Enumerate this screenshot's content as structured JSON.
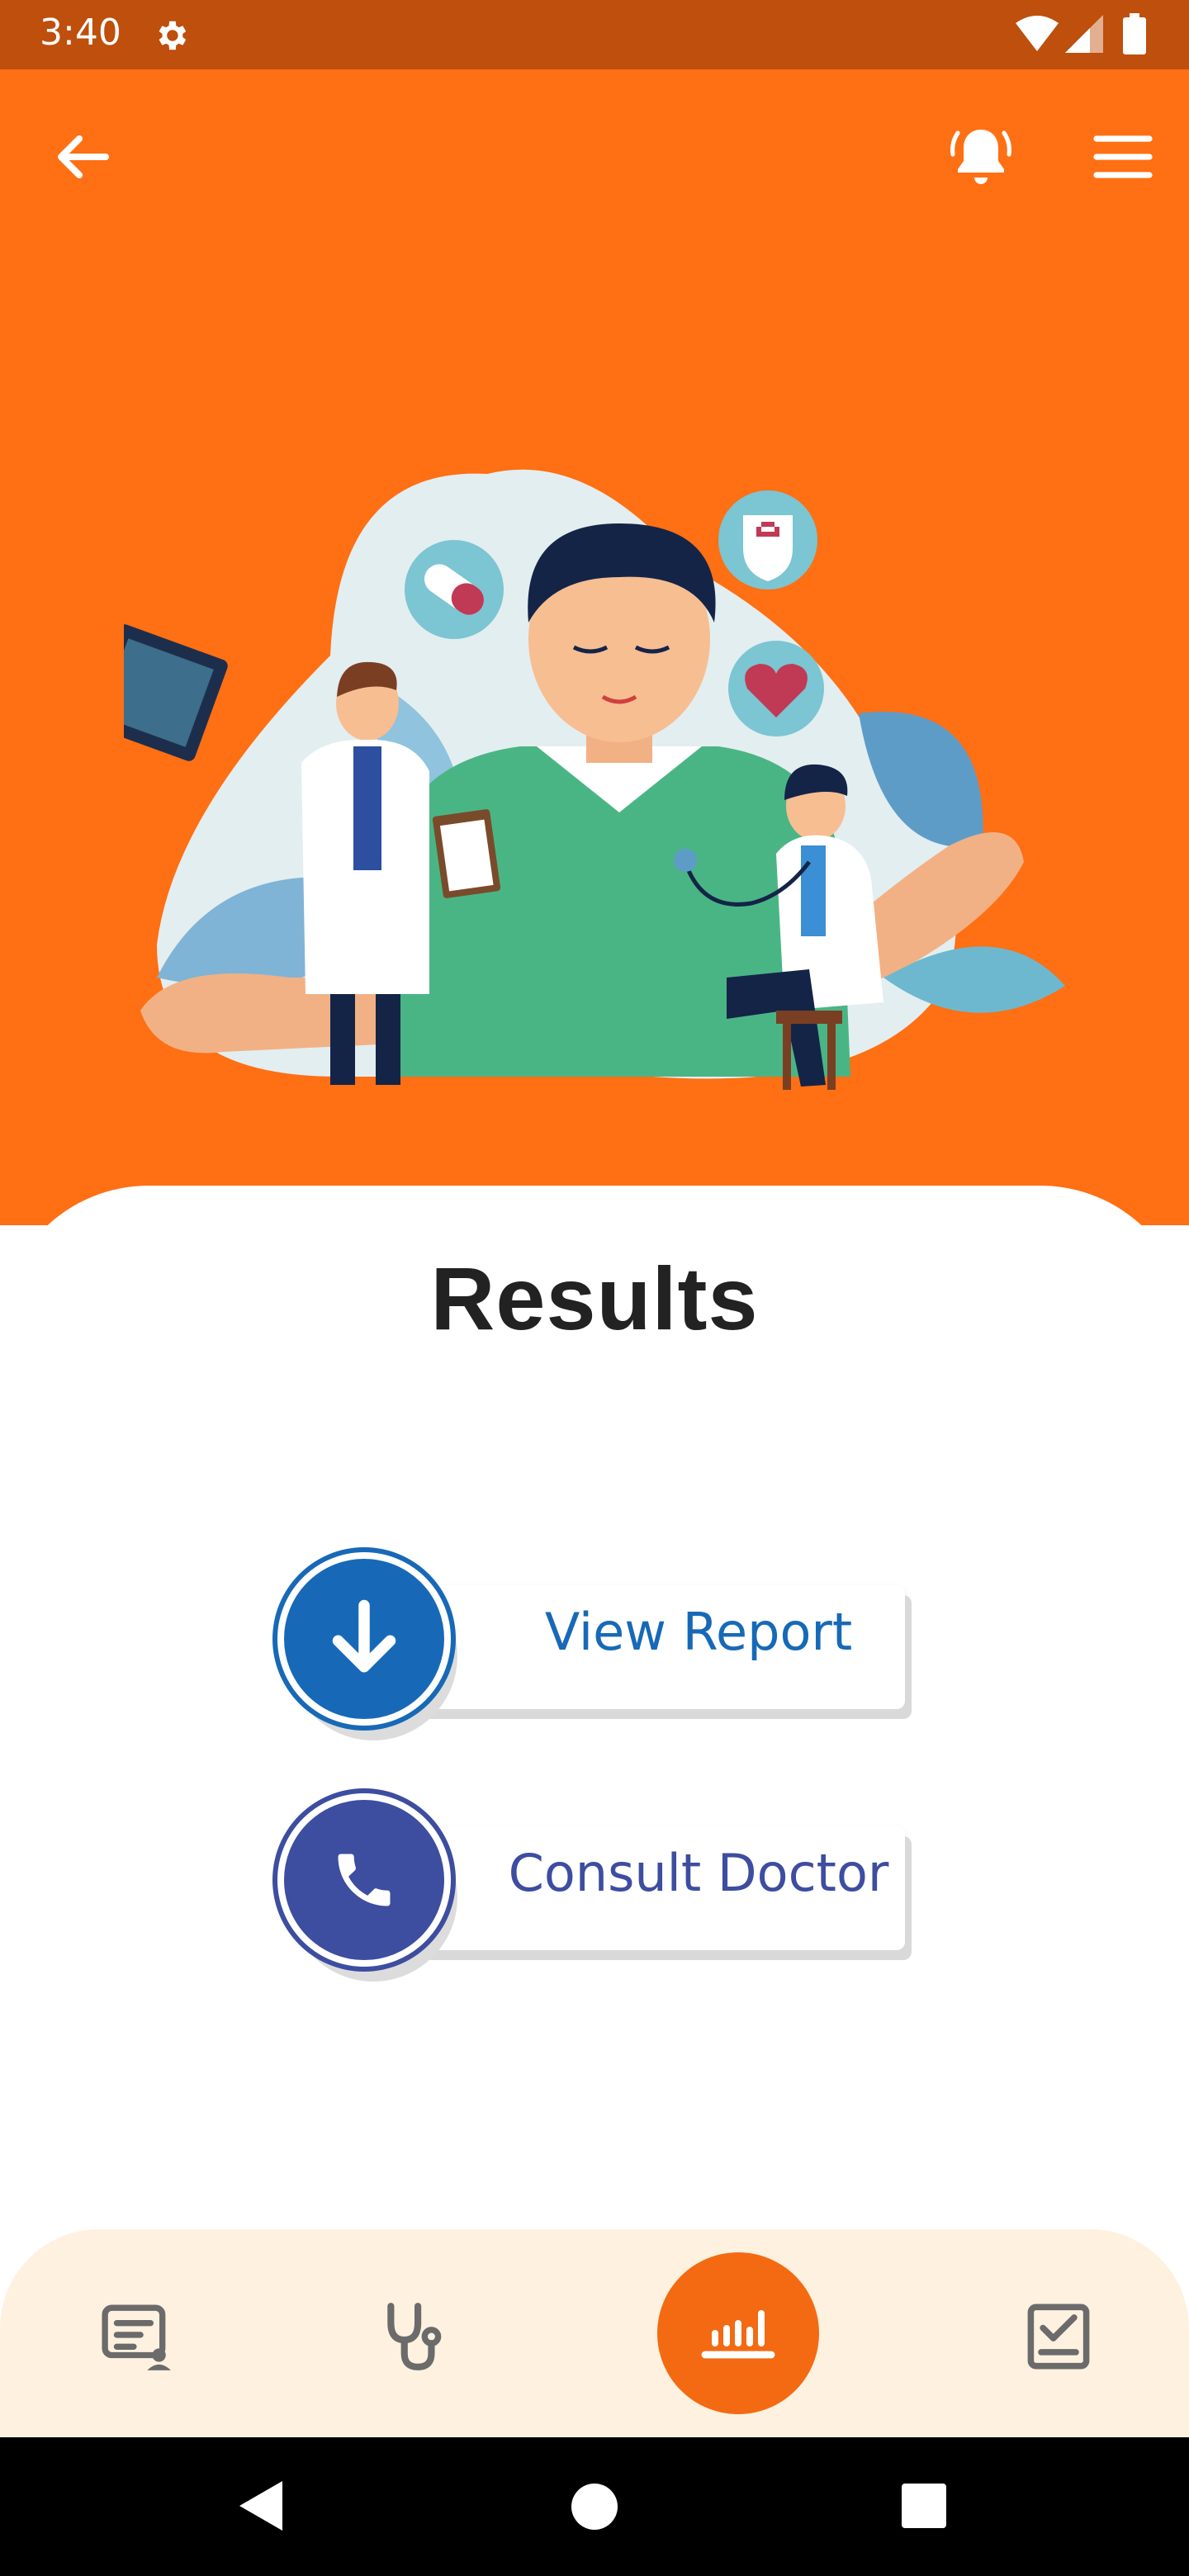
{
  "status_bar": {
    "time": "3:40",
    "icons": [
      "gear-icon",
      "wifi-icon",
      "signal-icon",
      "battery-icon"
    ]
  },
  "header": {
    "back_icon": "arrow-left-icon",
    "alarm_icon": "alarm-bell-icon",
    "menu_icon": "hamburger-menu-icon"
  },
  "hero": {
    "illustration": "doctors-and-patient-illustration"
  },
  "main": {
    "title": "Results",
    "actions": [
      {
        "label": "View Report",
        "icon": "download-arrow-icon",
        "color": "#1769B8"
      },
      {
        "label": "Consult Doctor",
        "icon": "phone-icon",
        "color": "#3D4DA0"
      }
    ]
  },
  "bottom_nav": {
    "items": [
      {
        "icon": "reports-list-icon"
      },
      {
        "icon": "stethoscope-icon"
      },
      {
        "icon": "results-chart-icon",
        "active": true
      },
      {
        "icon": "checklist-icon"
      }
    ],
    "active_color": "#F36A12",
    "background": "#FFF1DF"
  },
  "colors": {
    "primary_orange": "#FF6F14",
    "status_bar": "#BE4F0C"
  }
}
